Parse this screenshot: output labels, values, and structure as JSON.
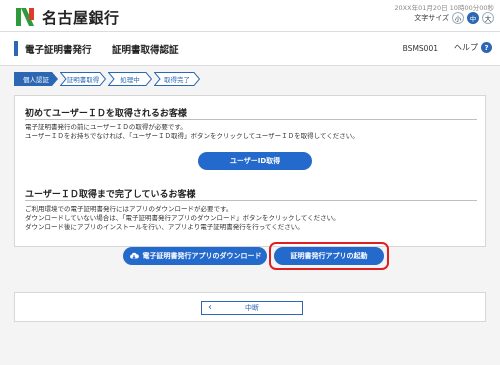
{
  "header": {
    "bank_name": "名古屋銀行",
    "datetime": "20XX年01月20日 10時00分00秒",
    "font_size_label": "文字サイズ",
    "font_sizes": [
      "小",
      "中",
      "大"
    ],
    "active_font_size": "中"
  },
  "titlebar": {
    "main_title": "電子証明書発行",
    "sub_title": "証明書取得認証",
    "screen_id": "BSMS001",
    "help_label": "ヘルプ",
    "help_icon_glyph": "?"
  },
  "steps": [
    "個人認証",
    "証明書取得",
    "処理中",
    "取得完了"
  ],
  "section1": {
    "title": "初めてユーザーＩＤを取得されるお客様",
    "text_line1": "電子証明書発行の前にユーザーＩＤの取得が必要です。",
    "text_line2": "ユーザーＩＤをお持ちでなければ、「ユーザーＩＤ取得」ボタンをクリックしてユーザーＩＤを取得してください。",
    "button_label": "ユーザーID取得"
  },
  "section2": {
    "title": "ユーザーＩＤ取得まで完了しているお客様",
    "text_line1": "ご利用環境での電子証明書発行にはアプリのダウンロードが必要です。",
    "text_line2": "ダウンロードしていない場合は、「電子証明書発行アプリのダウンロード」ボタンをクリックしてください。",
    "text_line3": "ダウンロード後にアプリのインストールを行い、アプリより電子証明書発行を行ってください。",
    "download_button_label": "電子証明書発行アプリのダウンロード",
    "launch_button_label": "証明書発行アプリの起動"
  },
  "footer": {
    "back_label": "中断",
    "back_chevron": "‹"
  },
  "colors": {
    "accent": "#2c67b3",
    "button_blue": "#2469cc",
    "highlight_red": "#e02020",
    "logo_green": "#2e9b3a"
  }
}
